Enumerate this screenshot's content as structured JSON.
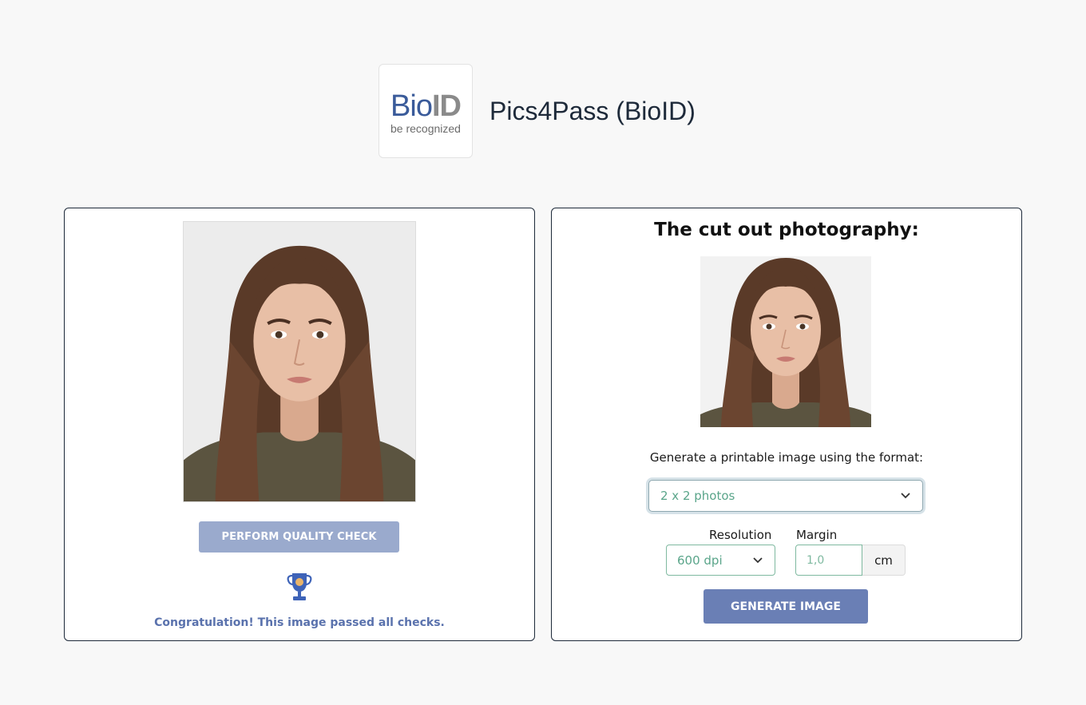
{
  "header": {
    "logo_text_bio": "Bio",
    "logo_text_id": "ID",
    "logo_tagline": "be recognized",
    "app_title": "Pics4Pass (BioID)"
  },
  "left_panel": {
    "photo_alt": "portrait photograph",
    "quality_button_label": "PERFORM QUALITY CHECK",
    "result_icon": "trophy-icon",
    "result_message": "Congratulation! This image passed all checks."
  },
  "right_panel": {
    "title": "The cut out photography:",
    "format_label": "Generate a printable image using the format:",
    "format_select_value": "2 x 2 photos",
    "resolution_label": "Resolution",
    "resolution_value": "600 dpi",
    "margin_label": "Margin",
    "margin_value": "1,0",
    "margin_unit": "cm",
    "generate_button_label": "GENERATE IMAGE"
  },
  "colors": {
    "panel_border": "#1e2a3a",
    "quality_button": "#9aaacd",
    "generate_button": "#6a7fb5",
    "success_text": "#5a72ad",
    "input_accent": "#5aa58a"
  }
}
